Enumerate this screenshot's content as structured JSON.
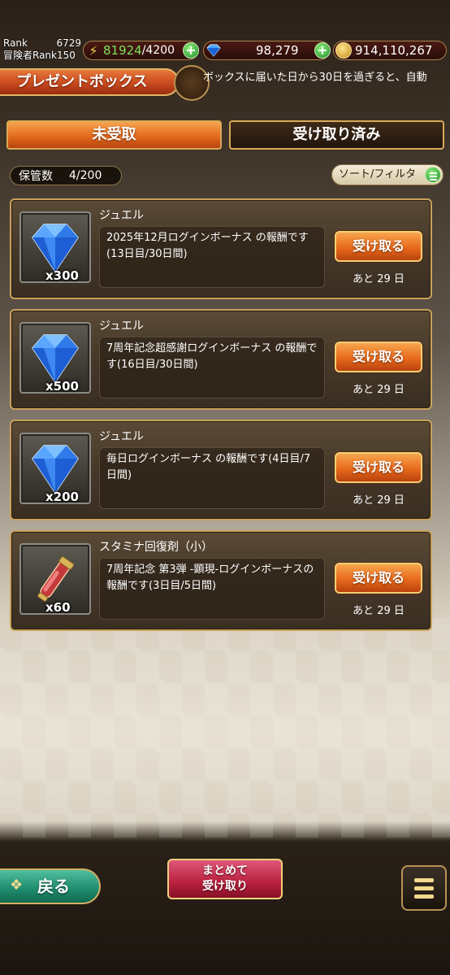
{
  "status": {
    "rank_label": "Rank",
    "rank_value": "6729",
    "adv_rank_label": "冒険者Rank150",
    "stamina_current": "81924",
    "stamina_max": "/4200",
    "gems": "98,279",
    "gold": "914,110,267"
  },
  "header": {
    "title": "プレゼントボックス",
    "ticker": "ボックスに届いた日から30日を過ぎると、自動"
  },
  "tabs": {
    "unclaimed": "未受取",
    "claimed": "受け取り済み"
  },
  "storage": {
    "label": "保管数",
    "value": "4/200"
  },
  "sort": {
    "label": "ソート/フィルタ"
  },
  "items": [
    {
      "name": "ジュエル",
      "qty": "x300",
      "desc": "2025年12月ログインボーナス の報酬です(13日目/30日間)",
      "button": "受け取る",
      "remain": "あと 29 日",
      "icon": "jewel-icon"
    },
    {
      "name": "ジュエル",
      "qty": "x500",
      "desc": "7周年記念超感謝ログインボーナス の報酬です(16日目/30日間)",
      "button": "受け取る",
      "remain": "あと 29 日",
      "icon": "jewel-icon"
    },
    {
      "name": "ジュエル",
      "qty": "x200",
      "desc": "毎日ログインボーナス の報酬です(4日目/7日間)",
      "button": "受け取る",
      "remain": "あと 29 日",
      "icon": "jewel-icon"
    },
    {
      "name": "スタミナ回復剤（小）",
      "qty": "x60",
      "desc": "7周年記念 第3弾 -顕現-ログインボーナスの報酬です(3日目/5日間)",
      "button": "受け取る",
      "remain": "あと 29 日",
      "icon": "stamina-potion-icon"
    }
  ],
  "bottom": {
    "back": "戻る",
    "bulk_line1": "まとめて",
    "bulk_line2": "受け取り"
  },
  "colors": {
    "accent_orange": "#e46b1e",
    "gold_border": "#c9a25b",
    "stamina_green": "#7ee05a",
    "back_green": "#1e8a6c",
    "bulk_red": "#b8203e"
  }
}
